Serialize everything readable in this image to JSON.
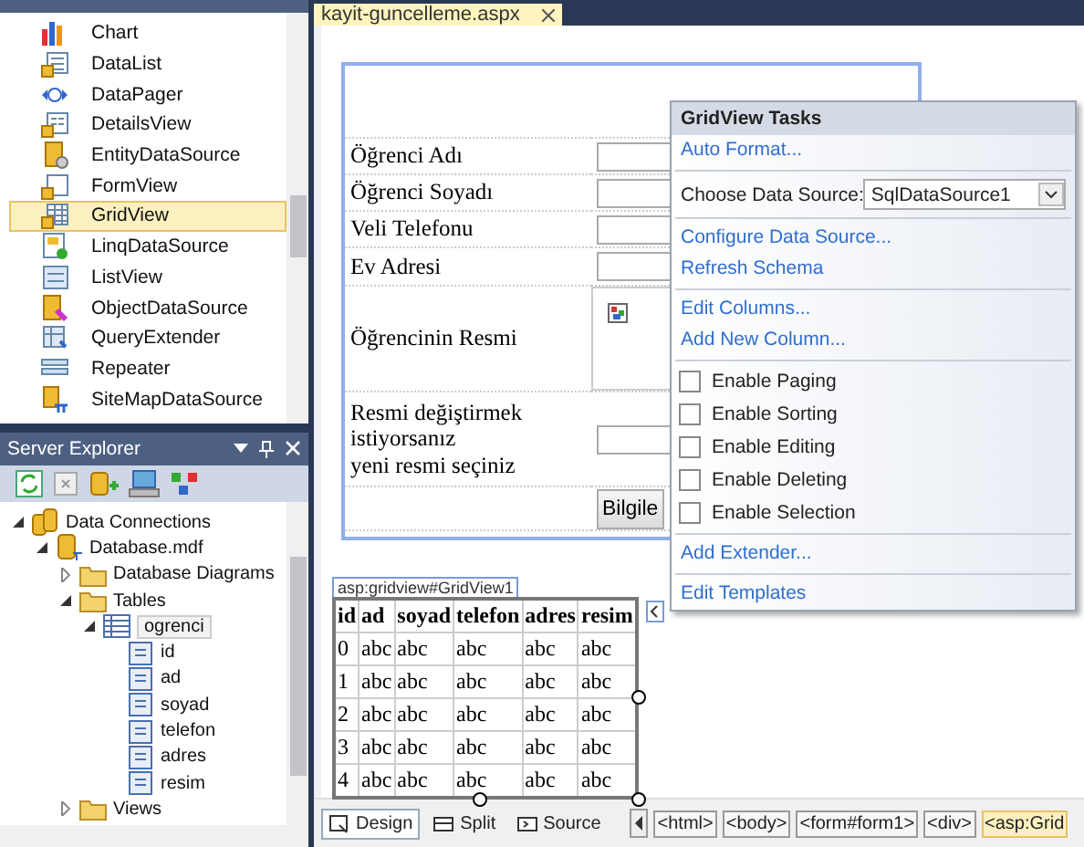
{
  "toolbox": {
    "items": [
      {
        "label": "Chart",
        "selected": false
      },
      {
        "label": "DataList",
        "selected": false
      },
      {
        "label": "DataPager",
        "selected": false
      },
      {
        "label": "DetailsView",
        "selected": false
      },
      {
        "label": "EntityDataSource",
        "selected": false
      },
      {
        "label": "FormView",
        "selected": false
      },
      {
        "label": "GridView",
        "selected": true
      },
      {
        "label": "LinqDataSource",
        "selected": false
      },
      {
        "label": "ListView",
        "selected": false
      },
      {
        "label": "ObjectDataSource",
        "selected": false
      },
      {
        "label": "QueryExtender",
        "selected": false
      },
      {
        "label": "Repeater",
        "selected": false
      },
      {
        "label": "SiteMapDataSource",
        "selected": false
      }
    ]
  },
  "server_explorer": {
    "title": "Server Explorer",
    "tree": [
      {
        "label": "Data Connections",
        "kind": "connections",
        "expanded": true,
        "selected": false,
        "children": [
          {
            "label": "Database.mdf",
            "kind": "database",
            "expanded": true,
            "selected": false,
            "children": [
              {
                "label": "Database Diagrams",
                "kind": "folder",
                "expanded": false,
                "selected": false
              },
              {
                "label": "Tables",
                "kind": "folder",
                "expanded": true,
                "selected": false,
                "children": [
                  {
                    "label": "ogrenci",
                    "kind": "table",
                    "expanded": true,
                    "selected": true,
                    "children": [
                      {
                        "label": "id",
                        "kind": "column",
                        "selected": false
                      },
                      {
                        "label": "ad",
                        "kind": "column",
                        "selected": false
                      },
                      {
                        "label": "soyad",
                        "kind": "column",
                        "selected": false
                      },
                      {
                        "label": "telefon",
                        "kind": "column",
                        "selected": false
                      },
                      {
                        "label": "adres",
                        "kind": "column",
                        "selected": false
                      },
                      {
                        "label": "resim",
                        "kind": "column",
                        "selected": false
                      }
                    ]
                  }
                ]
              },
              {
                "label": "Views",
                "kind": "folder",
                "expanded": false,
                "selected": false
              }
            ]
          }
        ]
      }
    ]
  },
  "document_tab": {
    "title": "kayit-guncelleme.aspx"
  },
  "form": {
    "rows": [
      {
        "label": "Öğrenci Adı",
        "kind": "text"
      },
      {
        "label": "Öğrenci Soyadı",
        "kind": "text"
      },
      {
        "label": "Veli Telefonu",
        "kind": "text"
      },
      {
        "label": "Ev Adresi",
        "kind": "text"
      },
      {
        "label": "Öğrencinin Resmi",
        "kind": "image"
      },
      {
        "label": "Resmi değiştirmek\nistiyorsanız\nyeni resmi seçiniz",
        "kind": "file"
      }
    ],
    "button": "Bilgile"
  },
  "gridview": {
    "tag": "asp:gridview#GridView1",
    "columns": [
      "id",
      "ad",
      "soyad",
      "telefon",
      "adres",
      "resim"
    ],
    "rows": [
      [
        "0",
        "abc",
        "abc",
        "abc",
        "abc",
        "abc"
      ],
      [
        "1",
        "abc",
        "abc",
        "abc",
        "abc",
        "abc"
      ],
      [
        "2",
        "abc",
        "abc",
        "abc",
        "abc",
        "abc"
      ],
      [
        "3",
        "abc",
        "abc",
        "abc",
        "abc",
        "abc"
      ],
      [
        "4",
        "abc",
        "abc",
        "abc",
        "abc",
        "abc"
      ]
    ]
  },
  "tasks": {
    "title": "GridView Tasks",
    "items": [
      {
        "kind": "link",
        "label": "Auto Format..."
      },
      {
        "kind": "separator"
      },
      {
        "kind": "select",
        "label": "Choose Data Source:",
        "value": "SqlDataSource1"
      },
      {
        "kind": "separator"
      },
      {
        "kind": "link",
        "label": "Configure Data Source..."
      },
      {
        "kind": "link",
        "label": "Refresh Schema"
      },
      {
        "kind": "separator"
      },
      {
        "kind": "link",
        "label": "Edit Columns..."
      },
      {
        "kind": "link",
        "label": "Add New Column..."
      },
      {
        "kind": "separator"
      },
      {
        "kind": "checkbox",
        "label": "Enable Paging",
        "checked": false
      },
      {
        "kind": "checkbox",
        "label": "Enable Sorting",
        "checked": false
      },
      {
        "kind": "checkbox",
        "label": "Enable Editing",
        "checked": false
      },
      {
        "kind": "checkbox",
        "label": "Enable Deleting",
        "checked": false
      },
      {
        "kind": "checkbox",
        "label": "Enable Selection",
        "checked": false
      },
      {
        "kind": "separator"
      },
      {
        "kind": "link",
        "label": "Add Extender..."
      },
      {
        "kind": "separator"
      },
      {
        "kind": "link",
        "label": "Edit Templates"
      }
    ]
  },
  "view_tabs": [
    {
      "label": "Design",
      "selected": true
    },
    {
      "label": "Split",
      "selected": false
    },
    {
      "label": "Source",
      "selected": false
    }
  ],
  "breadcrumb": [
    {
      "label": "<html>",
      "selected": false
    },
    {
      "label": "<body>",
      "selected": false
    },
    {
      "label": "<form#form1>",
      "selected": false
    },
    {
      "label": "<div>",
      "selected": false
    },
    {
      "label": "<asp:Grid",
      "selected": true
    }
  ]
}
